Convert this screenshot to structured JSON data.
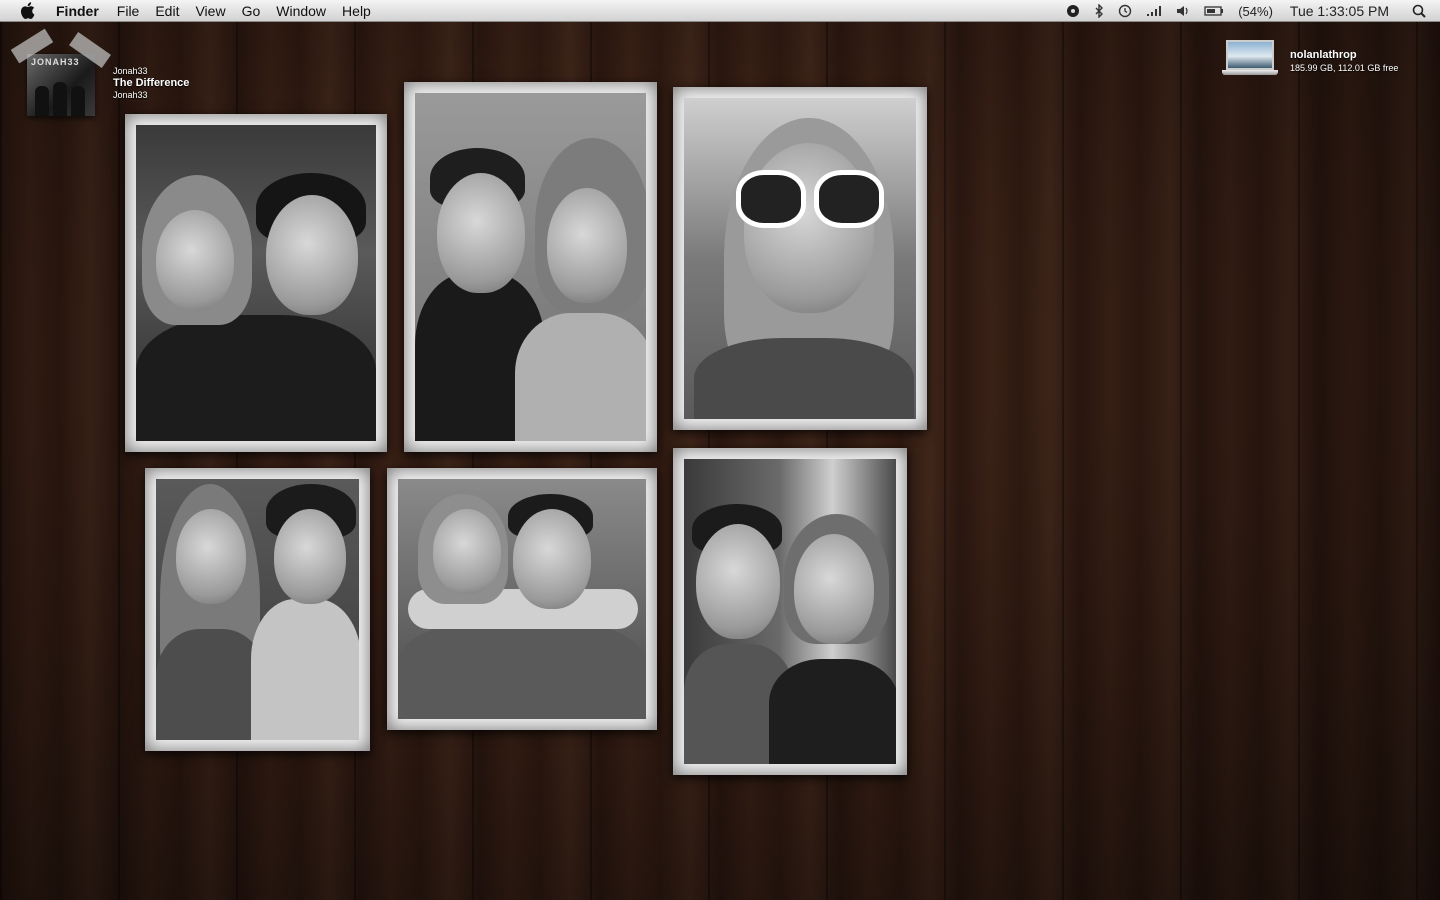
{
  "menubar": {
    "app_name": "Finder",
    "menus": [
      "File",
      "Edit",
      "View",
      "Go",
      "Window",
      "Help"
    ],
    "battery_percent": "(54%)",
    "clock": "Tue 1:33:05 PM"
  },
  "itunes_widget": {
    "cover_text": "JONAH33",
    "artist": "Jonah33",
    "track": "The Difference",
    "album": "Jonah33"
  },
  "drive": {
    "name": "nolanlathrop",
    "info": "185.99 GB, 112.01 GB free"
  },
  "icons": {
    "menubar": [
      "apple-icon",
      "record-icon",
      "bluetooth-icon",
      "time-machine-icon",
      "wifi-signal-icon",
      "volume-icon",
      "battery-icon",
      "spotlight-icon"
    ],
    "desktop": [
      "laptop-drive-icon"
    ]
  },
  "photos": [
    {
      "id": "photo-1",
      "subject": "couple-1"
    },
    {
      "id": "photo-2",
      "subject": "couple-2"
    },
    {
      "id": "photo-3",
      "subject": "girl-sunglasses"
    },
    {
      "id": "photo-4",
      "subject": "couple-3"
    },
    {
      "id": "photo-5",
      "subject": "couple-hug"
    },
    {
      "id": "photo-6",
      "subject": "couple-4"
    }
  ],
  "colors": {
    "wood": "#3a2116",
    "menubar": "#e4e4e4",
    "photo_frame": "#f2f2f2"
  }
}
